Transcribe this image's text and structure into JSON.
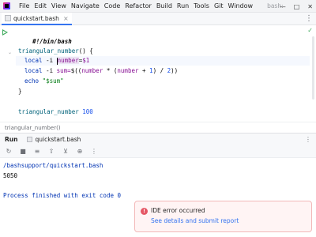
{
  "menu": {
    "items": [
      {
        "label": "File"
      },
      {
        "label": "Edit"
      },
      {
        "label": "View"
      },
      {
        "label": "Navigate"
      },
      {
        "label": "Code"
      },
      {
        "label": "Refactor"
      },
      {
        "label": "Build"
      },
      {
        "label": "Run"
      },
      {
        "label": "Tools"
      },
      {
        "label": "Git"
      },
      {
        "label": "Window"
      }
    ],
    "project": "bash:"
  },
  "editor": {
    "tab": {
      "label": "quickstart.bash",
      "icon": "file-icon",
      "close": "×"
    },
    "lines": {
      "l1": "#!/bin/bash",
      "l3a": "triangular_number",
      "l3b": "() {",
      "l4a": "local",
      "l4b": "-i",
      "l4c": "number",
      "l4d": "=",
      "l4e": "$1",
      "l5a": "local",
      "l5b": "-i",
      "l5c": "sum=",
      "l5d": "$((",
      "l5e": "number",
      "l5f": " * (",
      "l5g": "number",
      "l5h": " + ",
      "l5i": "1",
      "l5j": ") / ",
      "l5k": "2",
      "l5l": "))",
      "l6a": "echo",
      "l6b": "\"$sum\"",
      "l7": "}",
      "l9a": "triangular_number",
      "l9b": "100"
    },
    "status": "✓"
  },
  "breadcrumb": "triangular_number()",
  "run": {
    "title": "Run",
    "tab": "quickstart.bash",
    "toolbar_icons": [
      "rerun-icon",
      "stop-icon",
      "wrap-icon",
      "pin-icon",
      "filter-icon",
      "debug-icon",
      "more-icon"
    ],
    "console": {
      "path": "/bashsupport/quickstart.bash",
      "output": "5050",
      "exit": "Process finished with exit code 0"
    }
  },
  "notification": {
    "title": "IDE error occurred",
    "link": "See details and submit report"
  },
  "colors": {
    "accent": "#3574f0",
    "run_green": "#3eaa5c",
    "error_red": "#e55765"
  }
}
